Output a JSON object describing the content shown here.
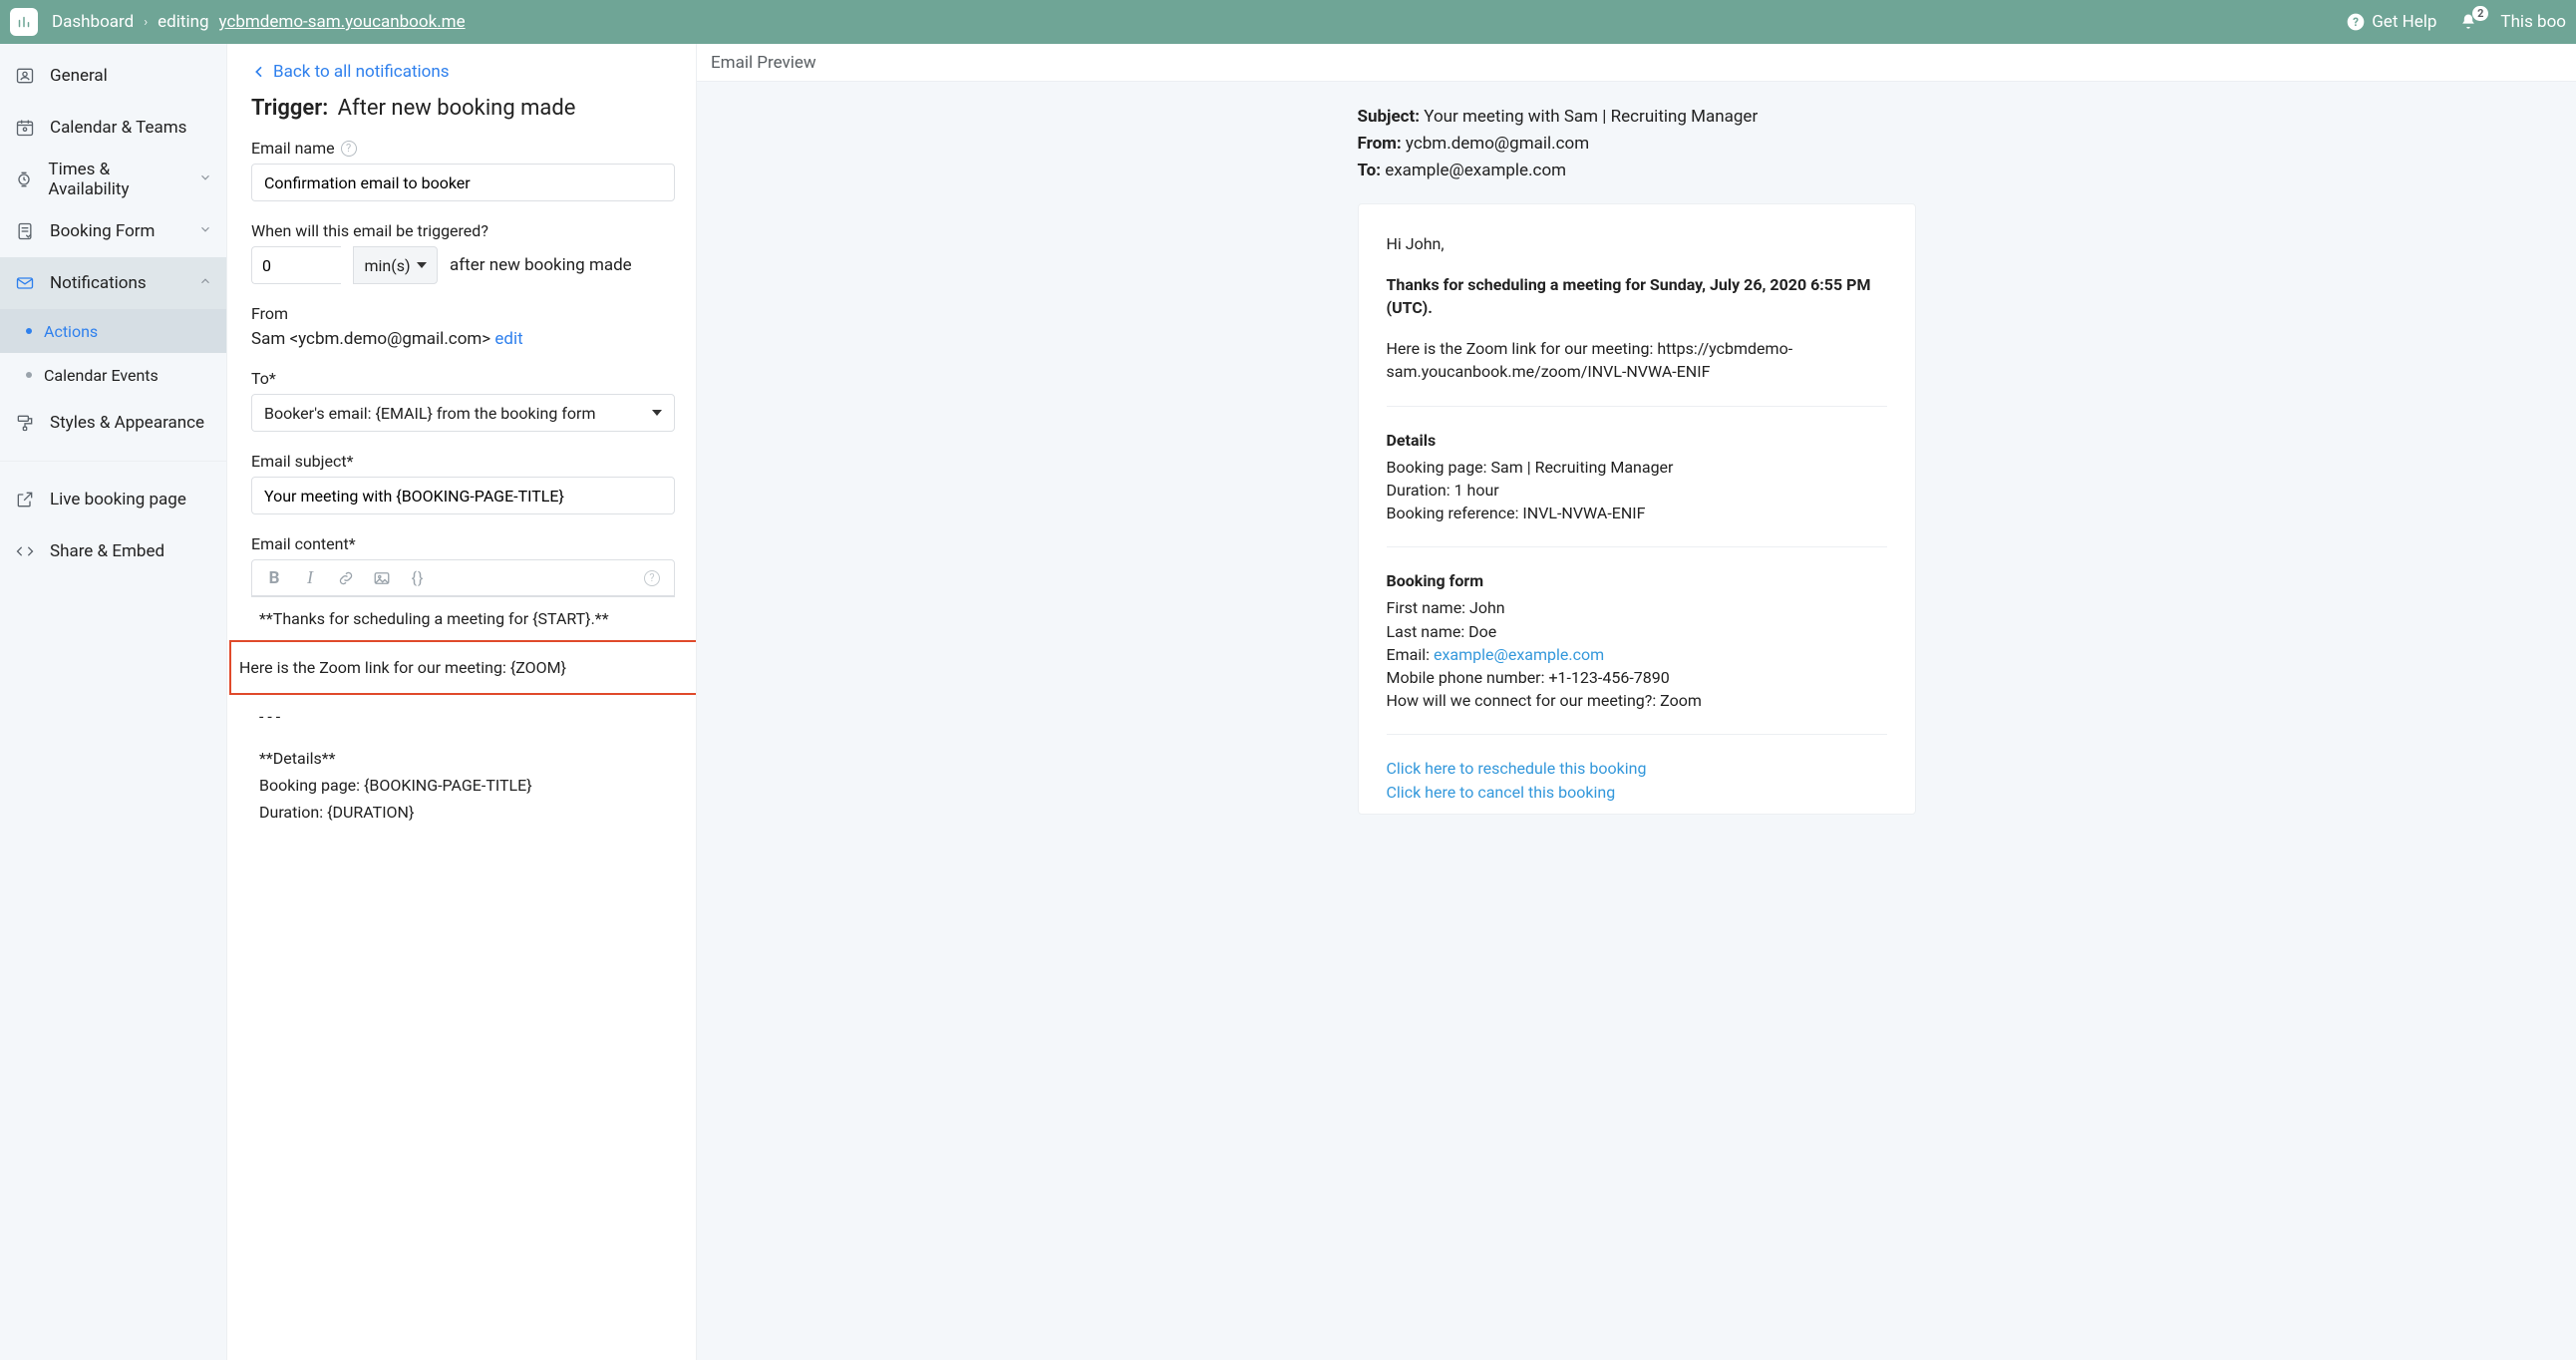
{
  "topbar": {
    "dashboard": "Dashboard",
    "editing": "editing",
    "page_url": "ycbmdemo-sam.youcanbook.me",
    "get_help": "Get Help",
    "notif_count": "2",
    "this_book": "This boo"
  },
  "sidebar": {
    "items": {
      "general": "General",
      "calendar_teams": "Calendar & Teams",
      "times": "Times & Availability",
      "booking_form": "Booking Form",
      "notifications": "Notifications",
      "styles": "Styles & Appearance",
      "live": "Live booking page",
      "share": "Share & Embed"
    },
    "sub": {
      "actions": "Actions",
      "calendar_events": "Calendar Events"
    }
  },
  "editor": {
    "back": "Back to all notifications",
    "trigger_prefix": "Trigger:",
    "trigger_value": "After new booking made",
    "email_name_label": "Email name",
    "email_name_value": "Confirmation email to booker",
    "when_label": "When will this email be triggered?",
    "when_num": "0",
    "when_unit": "min(s)",
    "when_after": "after new booking made",
    "from_label": "From",
    "from_value": "Sam <ycbm.demo@gmail.com>",
    "from_edit": "edit",
    "to_label": "To*",
    "to_value": "Booker's email: {EMAIL} from the booking form",
    "subject_label": "Email subject*",
    "subject_value": "Your meeting with {BOOKING-PAGE-TITLE}",
    "content_label": "Email content*",
    "content_line1": "**Thanks for scheduling a meeting for {START}.**",
    "content_zoom": "Here is the Zoom link for our meeting: {ZOOM}",
    "content_hr": "- - -",
    "content_details_h": "**Details**",
    "content_details_1": "Booking page: {BOOKING-PAGE-TITLE}",
    "content_details_2": "Duration: {DURATION}"
  },
  "preview": {
    "header": "Email Preview",
    "subject_label": "Subject:",
    "subject_value": "Your meeting with Sam | Recruiting Manager",
    "from_label": "From:",
    "from_value": "ycbm.demo@gmail.com",
    "to_label": "To:",
    "to_value": "example@example.com",
    "greeting": "Hi John,",
    "thanks": "Thanks for scheduling a meeting for Sunday, July 26, 2020 6:55 PM (UTC).",
    "zoom_text": "Here is the Zoom link for our meeting: https://ycbmdemo-sam.youcanbook.me/zoom/INVL-NVWA-ENIF",
    "details_h": "Details",
    "details_1": "Booking page: Sam | Recruiting Manager",
    "details_2": "Duration: 1 hour",
    "details_3": "Booking reference: INVL-NVWA-ENIF",
    "form_h": "Booking form",
    "form_1": "First name: John",
    "form_2": "Last name: Doe",
    "form_3_label": "Email: ",
    "form_3_link": "example@example.com",
    "form_4": "Mobile phone number: +1-123-456-7890",
    "form_5": "How will we connect for our meeting?: Zoom",
    "link_reschedule": "Click here to reschedule this booking",
    "link_cancel": "Click here to cancel this booking"
  }
}
